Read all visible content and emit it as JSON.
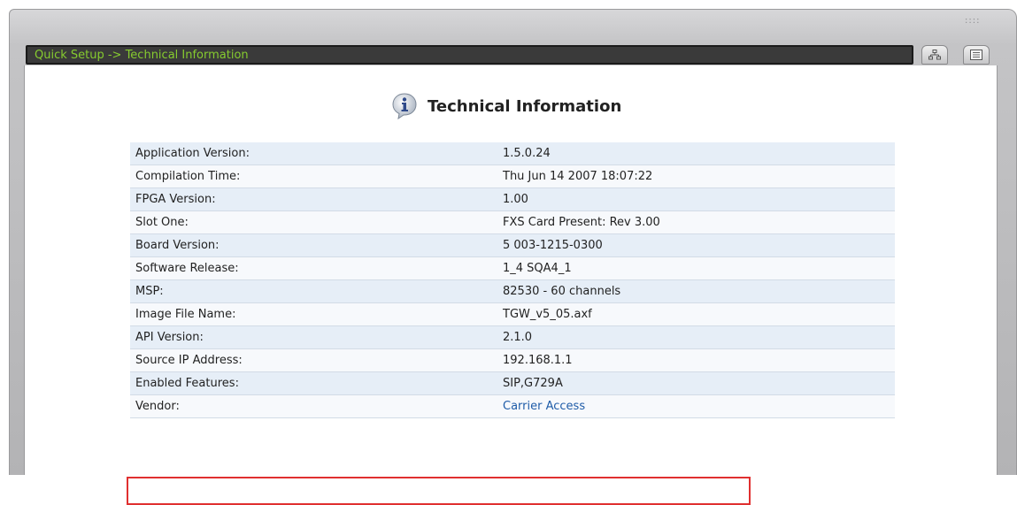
{
  "window": {
    "breadcrumb": "Quick Setup -> Technical Information",
    "grip_text": "::::"
  },
  "toolbar": {
    "buttons": [
      {
        "icon": "network-tree-icon"
      },
      {
        "icon": "document-list-icon"
      }
    ]
  },
  "page": {
    "title": "Technical Information",
    "title_icon": "info-icon"
  },
  "rows": [
    {
      "label": "Application Version:",
      "value": "1.5.0.24"
    },
    {
      "label": "Compilation Time:",
      "value": "Thu Jun 14 2007 18:07:22"
    },
    {
      "label": "FPGA Version:",
      "value": "1.00"
    },
    {
      "label": "Slot One:",
      "value": "FXS Card Present: Rev 3.00"
    },
    {
      "label": "Board Version:",
      "value": "5 003-1215-0300"
    },
    {
      "label": "Software Release:",
      "value": "1_4 SQA4_1"
    },
    {
      "label": "MSP:",
      "value": "82530 - 60 channels"
    },
    {
      "label": "Image File Name:",
      "value": "TGW_v5_05.axf"
    },
    {
      "label": "API Version:",
      "value": "2.1.0"
    },
    {
      "label": "Source IP Address:",
      "value": "192.168.1.1"
    },
    {
      "label": "Enabled Features:",
      "value": "SIP,G729A"
    },
    {
      "label": "Vendor:",
      "value": "Carrier Access"
    }
  ],
  "highlight": {
    "row_label": "Enabled Features:",
    "color": "#e03030"
  },
  "colors": {
    "breadcrumb_text": "#86cc2f",
    "row_alt": "#e6eef7",
    "link": "#1f5ca8"
  }
}
